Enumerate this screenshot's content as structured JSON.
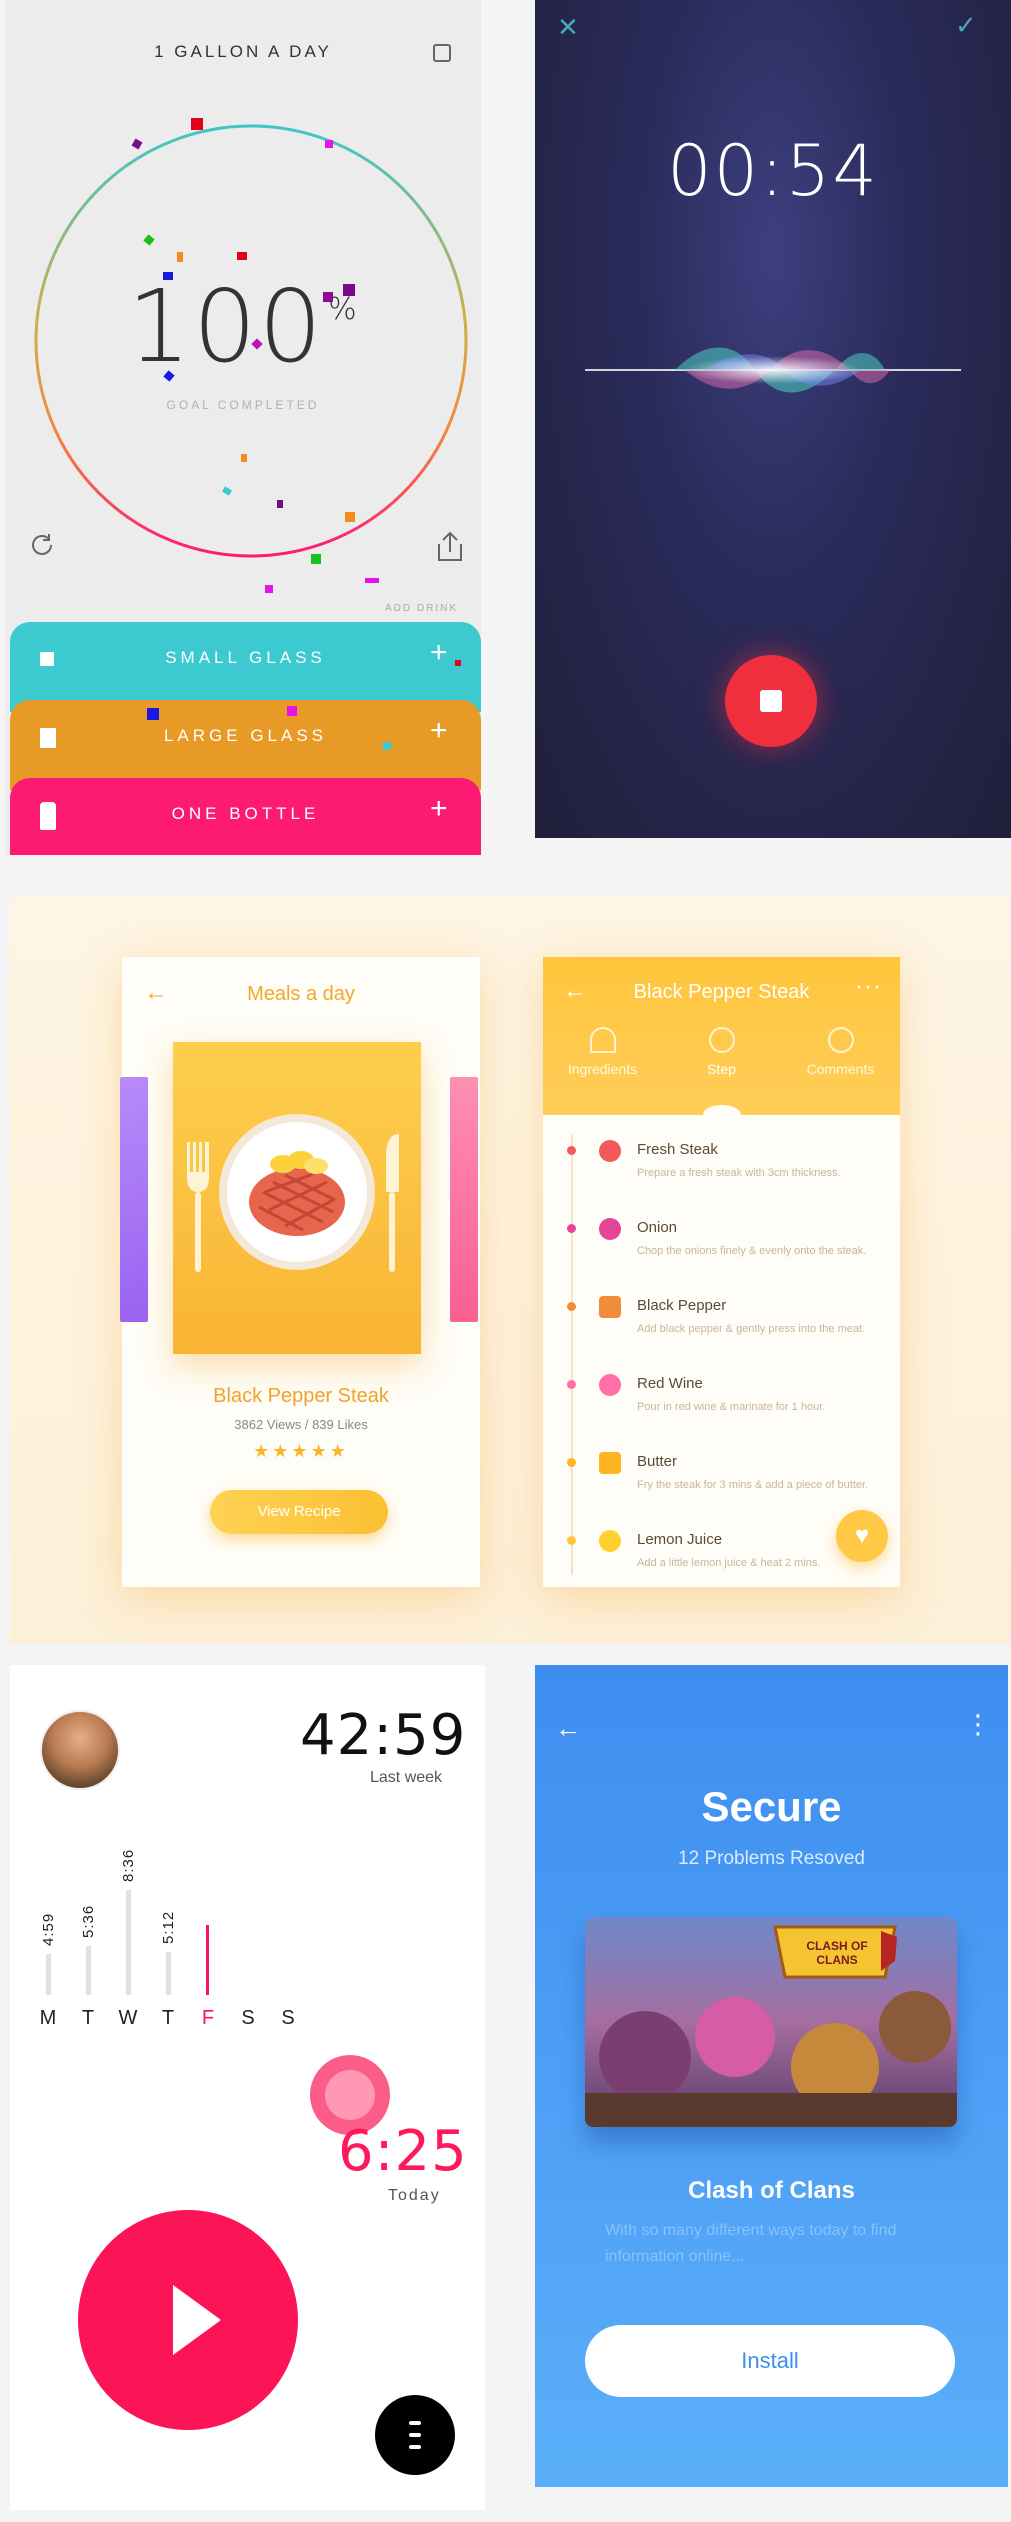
{
  "water": {
    "title": "1 GALLON A DAY",
    "percent": "100",
    "percent_sign": "%",
    "goal_label": "GOAL COMPLETED",
    "add_drink": "ADD DRINK",
    "drinks": [
      {
        "label": "SMALL GLASS",
        "color": "#3ccad0"
      },
      {
        "label": "LARGE GLASS",
        "color": "#e89a27"
      },
      {
        "label": "ONE BOTTLE",
        "color": "#fc1a72"
      }
    ],
    "plus": "+"
  },
  "recorder": {
    "time": "00:54",
    "close": "✕",
    "confirm": "✓",
    "accent": "#ef2e3e"
  },
  "recipe": {
    "list_title": "Meals a day",
    "back": "←",
    "dish_name": "Black Pepper Steak",
    "stats": "3862 Views / 839 Likes",
    "rating_stars": "★★★★★",
    "rating": 4.5,
    "button": "View Recipe",
    "detail_title": "Black Pepper Steak",
    "more": "···",
    "tabs": [
      "Ingredients",
      "Step",
      "Comments"
    ],
    "active_tab": "Step",
    "steps": [
      {
        "name": "Fresh Steak",
        "desc": "Prepare a fresh steak with 3cm thickness.",
        "icon": "steak-icon",
        "color": "#f05a5a"
      },
      {
        "name": "Onion",
        "desc": "Chop the onions finely & evenly onto the steak.",
        "icon": "onion-icon",
        "color": "#e64494"
      },
      {
        "name": "Black Pepper",
        "desc": "Add black pepper & gently press into the meat.",
        "icon": "pepper-icon",
        "color": "#f08c3a"
      },
      {
        "name": "Red Wine",
        "desc": "Pour in red wine & marinate for 1 hour.",
        "icon": "wine-icon",
        "color": "#ff6fa6"
      },
      {
        "name": "Butter",
        "desc": "Fry the steak for 3 mins & add a piece of butter.",
        "icon": "butter-icon",
        "color": "#ffb521"
      },
      {
        "name": "Lemon Juice",
        "desc": "Add a little lemon juice & heat 2 mins.",
        "icon": "lemon-icon",
        "color": "#ffd02e"
      }
    ],
    "heart": "♥",
    "accent": "#ffc53c"
  },
  "fitness": {
    "total": "42:59",
    "total_label": "Last week",
    "days": [
      {
        "day": "M",
        "value": "4:59",
        "level": 0.29
      },
      {
        "day": "T",
        "value": "5:36",
        "level": 0.35
      },
      {
        "day": "W",
        "value": "8:36",
        "level": 0.75
      },
      {
        "day": "T",
        "value": "5:12",
        "level": 0.31
      },
      {
        "day": "F",
        "value": "",
        "level": 0.5,
        "active": true
      },
      {
        "day": "S",
        "value": "",
        "level": 0
      },
      {
        "day": "S",
        "value": "",
        "level": 0
      }
    ],
    "today": "6:25",
    "today_label": "Today",
    "accent": "#fc1556"
  },
  "secure": {
    "back": "←",
    "more": "⋮",
    "title": "Secure",
    "subtitle": "12 Problems Resoved",
    "game_logo": "CLASH OF CLANS",
    "game_name": "Clash of Clans",
    "description": "With so many different ways today to find information online...",
    "button": "Install",
    "accent": "#3c8ef0"
  }
}
